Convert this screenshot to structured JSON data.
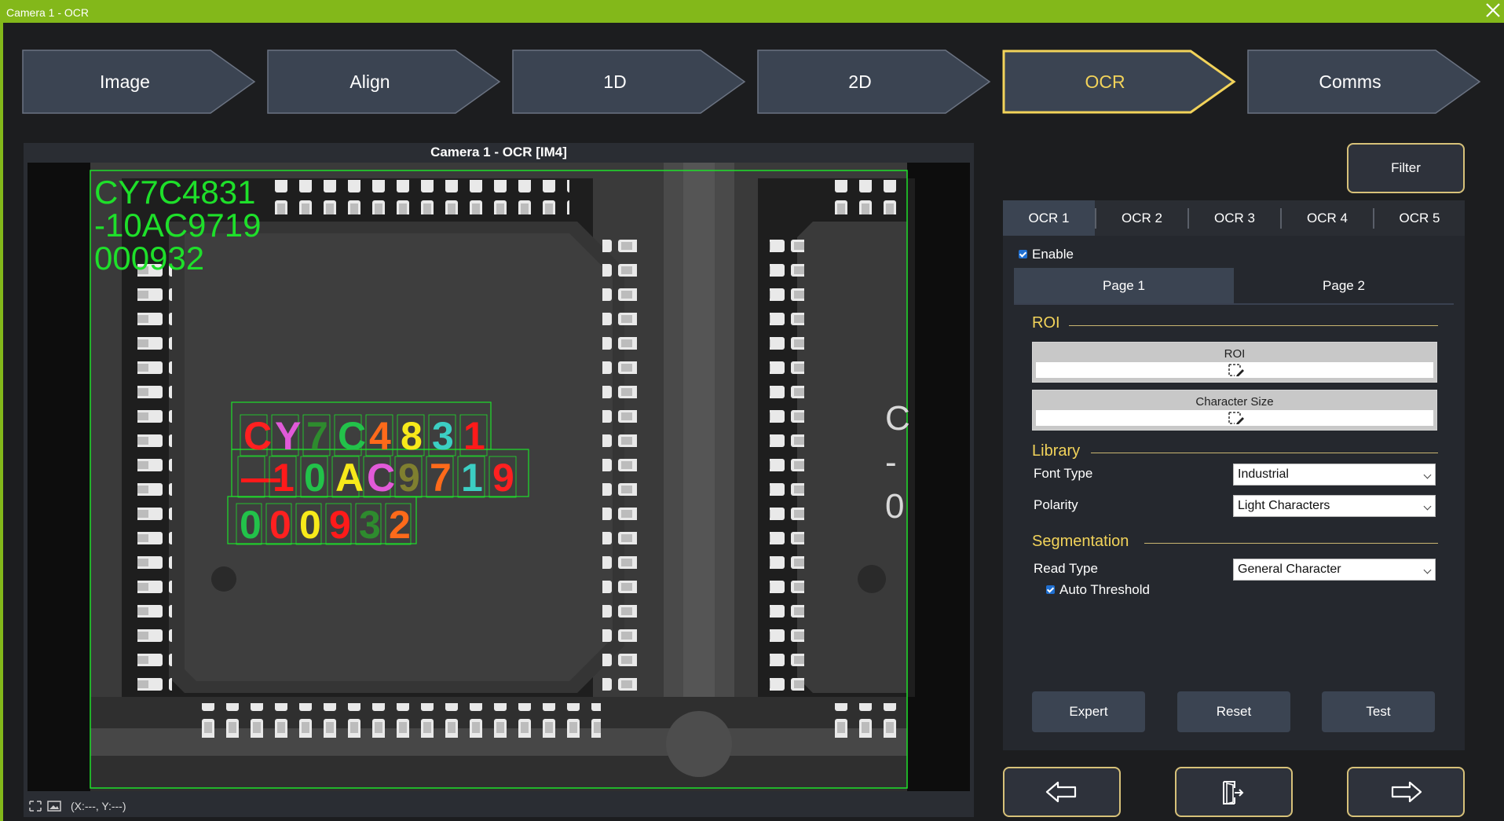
{
  "window": {
    "title": "Camera 1 - OCR",
    "close_icon": "close-icon"
  },
  "steps": [
    {
      "label": "Image"
    },
    {
      "label": "Align"
    },
    {
      "label": "1D"
    },
    {
      "label": "2D"
    },
    {
      "label": "OCR",
      "active": true
    },
    {
      "label": "Comms"
    }
  ],
  "viewer": {
    "title": "Camera 1 - OCR  [IM4]",
    "overlay_lines": [
      "CY7C4831",
      "-10AC9719",
      "000932"
    ],
    "ocr_line1": [
      "C",
      "Y",
      "7",
      "C",
      "4",
      "8",
      "3",
      "1"
    ],
    "ocr_line2": [
      "—",
      "1",
      "0",
      "A",
      "C",
      "9",
      "7",
      "1",
      "9"
    ],
    "ocr_line3": [
      "0",
      "0",
      "0",
      "9",
      "3",
      "2"
    ],
    "side_chars": [
      "C",
      "-",
      "0"
    ],
    "status_coords": "(X:---, Y:---)"
  },
  "colors": {
    "accent": "#f2d35a",
    "green_overlay": "#1ee02a",
    "title_bar": "#83b81a",
    "button": "#3b4452",
    "char_colors": [
      "#ff2020",
      "#e15ad8",
      "#2e8b2e",
      "#22c24a",
      "#ff6a1a",
      "#f7e91a",
      "#3ccfc3",
      "#ff1a1a",
      "#7f7f2f"
    ]
  },
  "right_panel": {
    "filter_label": "Filter",
    "ocr_tabs": [
      {
        "label": "OCR 1",
        "active": true
      },
      {
        "label": "OCR 2"
      },
      {
        "label": "OCR 3"
      },
      {
        "label": "OCR 4"
      },
      {
        "label": "OCR 5"
      }
    ],
    "enable_label": "Enable",
    "enable_checked": true,
    "page_tabs": [
      {
        "label": "Page 1",
        "active": true
      },
      {
        "label": "Page 2"
      }
    ],
    "roi_section": "ROI",
    "roi_label": "ROI",
    "charsize_label": "Character Size",
    "library_section": "Library",
    "font_type_label": "Font Type",
    "font_type_value": "Industrial",
    "polarity_label": "Polarity",
    "polarity_value": "Light Characters",
    "segmentation_section": "Segmentation",
    "read_type_label": "Read Type",
    "read_type_value": "General Character",
    "auto_threshold_label": "Auto Threshold",
    "auto_threshold_checked": true,
    "expert_label": "Expert",
    "reset_label": "Reset",
    "test_label": "Test"
  },
  "nav": {
    "back_icon": "arrow-left-icon",
    "exit_icon": "exit-door-icon",
    "next_icon": "arrow-right-icon"
  }
}
